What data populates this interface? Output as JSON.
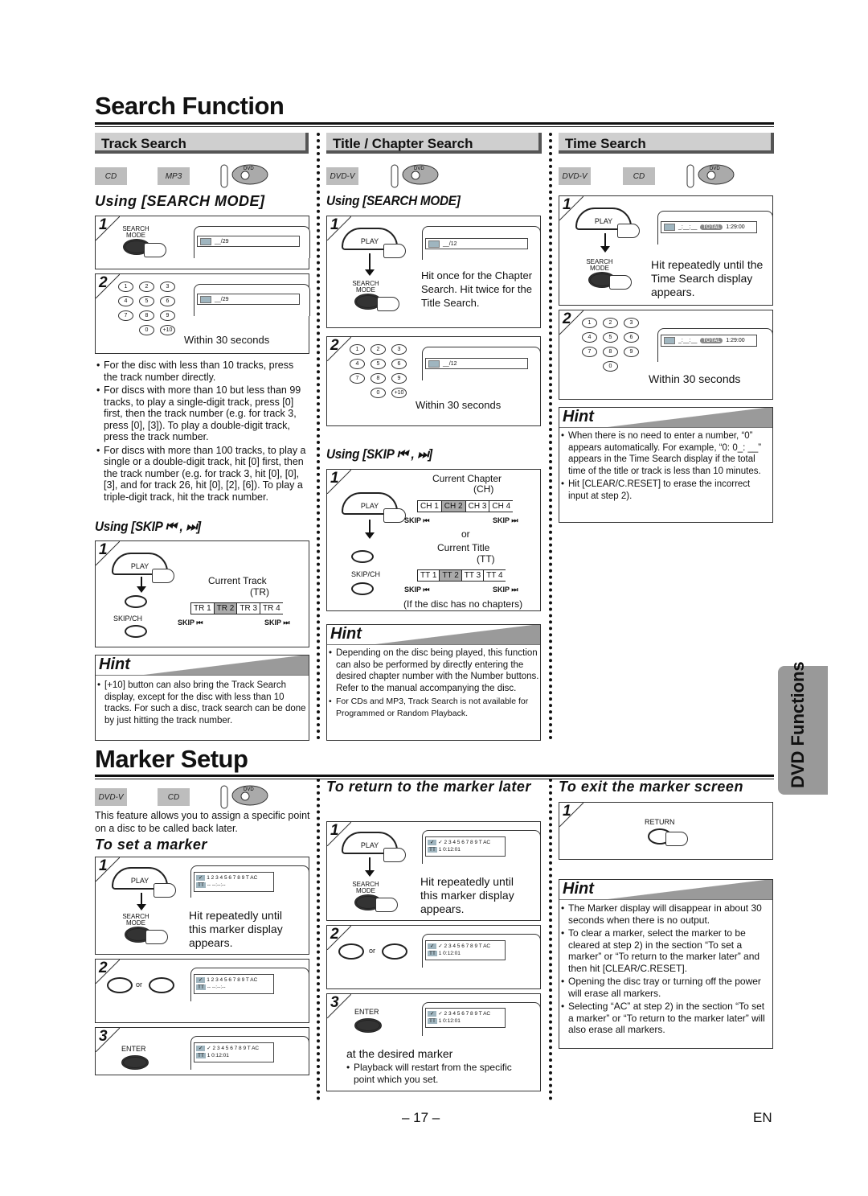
{
  "search_function": {
    "title": "Search Function",
    "track_search": {
      "header": "Track Search",
      "disc_badges": [
        "CD",
        "MP3"
      ],
      "remote_icon": "dvd-remote-icon",
      "using_search_mode": "Using [SEARCH MODE]",
      "step1": {
        "num": "1",
        "button": "SEARCH MODE",
        "lcd": "__/29"
      },
      "step2": {
        "num": "2",
        "keys": [
          "1",
          "2",
          "3",
          "4",
          "5",
          "6",
          "7",
          "8",
          "9",
          "0",
          "+10"
        ],
        "lcd": "__/29",
        "note": "Within 30 seconds"
      },
      "notes": [
        "For the disc with less than 10 tracks, press the track number directly.",
        "For discs with more than 10 but less than 99 tracks, to play a single-digit track, press [0] first, then the track number (e.g. for track 3, press [0], [3]). To play a double-digit track, press the track number.",
        "For discs with more than 100 tracks, to play a single or a double-digit track, hit [0] first, then the track number (e.g. for track 3, hit [0], [0], [3], and for track 26, hit [0], [2], [6]). To play a triple-digit track, hit the track number."
      ],
      "using_skip": "Using [SKIP ⏮ , ⏭]",
      "skip_step": {
        "num": "1",
        "play": "PLAY",
        "skipch": "SKIP/CH",
        "current_label": "Current Track",
        "current_abbr": "(TR)",
        "cells": [
          "TR 1",
          "TR 2",
          "TR 3",
          "TR 4"
        ],
        "highlight": 1,
        "skip_back": "SKIP ⏮",
        "skip_fwd": "SKIP ⏭"
      },
      "hint": {
        "title": "Hint",
        "items": [
          "[+10] button can also bring the Track Search display, except for the disc with less than 10 tracks. For such a disc, track search can be done by just hitting the track number."
        ]
      }
    },
    "title_chapter_search": {
      "header": "Title / Chapter Search",
      "disc_badges": [
        "DVD-V"
      ],
      "using_search_mode": "Using [SEARCH MODE]",
      "step1": {
        "num": "1",
        "play": "PLAY",
        "button": "SEARCH MODE",
        "lcd": "__/12",
        "text": "Hit once for the Chapter Search. Hit twice for the Title Search."
      },
      "step2": {
        "num": "2",
        "keys": [
          "1",
          "2",
          "3",
          "4",
          "5",
          "6",
          "7",
          "8",
          "9",
          "0",
          "+10"
        ],
        "lcd": "__/12",
        "note": "Within 30 seconds"
      },
      "using_skip": "Using [SKIP ⏮ , ⏭]",
      "skip_step": {
        "num": "1",
        "play": "PLAY",
        "skipch": "SKIP/CH",
        "chapter_label": "Current Chapter",
        "chapter_abbr": "(CH)",
        "chapter_cells": [
          "CH 1",
          "CH 2",
          "CH 3",
          "CH 4"
        ],
        "or": "or",
        "title_label": "Current Title",
        "title_abbr": "(TT)",
        "title_cells": [
          "TT 1",
          "TT 2",
          "TT 3",
          "TT 4"
        ],
        "highlight": 1,
        "skip_back": "SKIP ⏮",
        "skip_fwd": "SKIP ⏭",
        "footnote": "(If the disc has no chapters)"
      },
      "hint": {
        "title": "Hint",
        "items": [
          "Depending on the disc being played, this function can also be performed by directly entering the desired chapter number with the Number buttons. Refer to the manual accompanying the disc.",
          "For CDs and MP3, Track Search is not available for Programmed or Random Playback."
        ]
      }
    },
    "time_search": {
      "header": "Time Search",
      "disc_badges": [
        "DVD-V",
        "CD"
      ],
      "step1": {
        "num": "1",
        "play": "PLAY",
        "button": "SEARCH MODE",
        "lcd_time": "_:__:__",
        "lcd_total": "TOTAL",
        "lcd_total_time": "1:29:00",
        "text": "Hit repeatedly until the Time Search display appears."
      },
      "step2": {
        "num": "2",
        "keys": [
          "1",
          "2",
          "3",
          "4",
          "5",
          "6",
          "7",
          "8",
          "9",
          "0"
        ],
        "lcd_time": "_:__:__",
        "lcd_total": "TOTAL",
        "lcd_total_time": "1:29:00",
        "note": "Within 30 seconds"
      },
      "hint": {
        "title": "Hint",
        "items": [
          "When there is no need to enter a number, “0” appears automatically. For example, “0: 0_: __” appears in the Time Search display if the total time of the title or track is less than 10 minutes.",
          "Hit [CLEAR/C.RESET] to erase the incorrect input at step 2)."
        ]
      }
    }
  },
  "marker_setup": {
    "title": "Marker Setup",
    "disc_badges": [
      "DVD-V",
      "CD"
    ],
    "intro": "This feature allows you to assign a specific point on a disc to be called back later.",
    "set_marker": {
      "heading": "To set a marker",
      "step1": {
        "num": "1",
        "play": "PLAY",
        "button": "SEARCH MODE",
        "lcd_markers": "1 2 3 4 5 6 7 8 9 T AC",
        "lcd_tt": "TT",
        "lcd_time": "-- --:--:--",
        "text": "Hit repeatedly until this marker display appears."
      },
      "step2": {
        "num": "2",
        "or": "or",
        "lcd_markers": "1 2 3 4 5 6 7 8 9 T AC",
        "lcd_tt": "TT",
        "lcd_time": "-- --:--:--"
      },
      "step3": {
        "num": "3",
        "button": "ENTER",
        "lcd_markers": "✓ 2 3 4 5 6 7 8 9 T AC",
        "lcd_tt": "TT",
        "lcd_time": "1  0:12:01"
      }
    },
    "return_marker": {
      "heading": "To return to the marker later",
      "step1": {
        "num": "1",
        "play": "PLAY",
        "button": "SEARCH MODE",
        "lcd_markers": "✓ 2 3 4 5 6 7 8 9 T AC",
        "lcd_tt": "TT",
        "lcd_time": "1  0:12:01",
        "text": "Hit repeatedly until this marker display appears."
      },
      "step2": {
        "num": "2",
        "or": "or",
        "lcd_markers": "✓ 2 3 4 5 6 7 8 9 T AC",
        "lcd_tt": "TT",
        "lcd_time": "1  0:12:01"
      },
      "step3": {
        "num": "3",
        "button": "ENTER",
        "lcd_markers": "✓ 2 3 4 5 6 7 8 9 T AC",
        "lcd_tt": "TT",
        "lcd_time": "1  0:12:01",
        "text": "at the desired marker",
        "note": "Playback will restart from the specific point which you set."
      }
    },
    "exit_marker": {
      "heading": "To exit the marker screen",
      "step1": {
        "num": "1",
        "button": "RETURN"
      },
      "hint": {
        "title": "Hint",
        "items": [
          "The Marker display will disappear in about 30 seconds when there is no output.",
          "To clear a marker, select the marker to be cleared at step 2) in the section “To set a marker” or “To return to the marker later” and then hit [CLEAR/C.RESET].",
          "Opening the disc tray or turning off the power will erase all markers.",
          "Selecting “AC” at step 2) in the section “To set a marker” or “To return to the marker later” will also erase all markers."
        ]
      }
    }
  },
  "side_tab": "DVD Functions",
  "footer": {
    "page": "– 17 –",
    "lang": "EN"
  }
}
